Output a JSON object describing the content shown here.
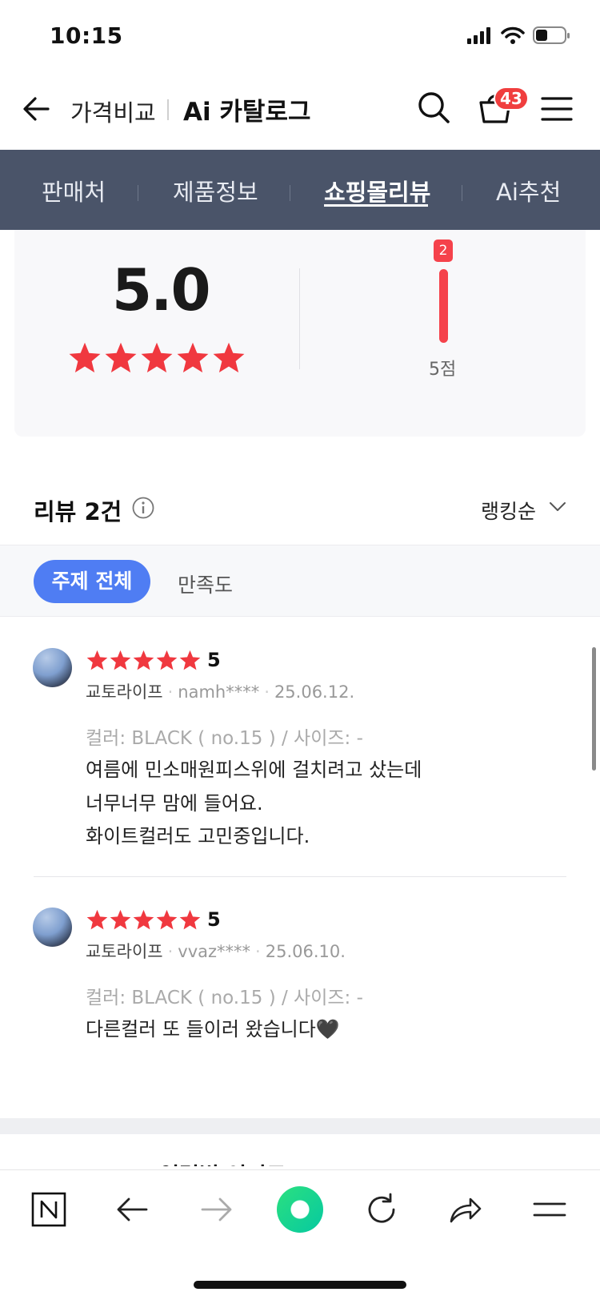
{
  "status_bar": {
    "time": "10:15"
  },
  "header": {
    "title_primary": "가격비교",
    "title_secondary": "Ai 카탈로그",
    "cart_badge": "43"
  },
  "tabs": [
    {
      "label": "판매처",
      "active": false
    },
    {
      "label": "제품정보",
      "active": false
    },
    {
      "label": "쇼핑몰리뷰",
      "active": true
    },
    {
      "label": "Ai추천",
      "active": false
    }
  ],
  "rating_summary": {
    "score": "5.0",
    "stars": 5,
    "distribution": [
      {
        "label": "5점",
        "count": "2"
      }
    ]
  },
  "reviews_header": {
    "title": "리뷰 2건",
    "sort_label": "랭킹순"
  },
  "filters": {
    "active": "주제 전체",
    "other": "만족도"
  },
  "reviews": [
    {
      "score": "5",
      "shop": "교토라이프",
      "user": "namh****",
      "date": "25.06.12.",
      "option": "컬러: BLACK ( no.15 ) / 사이즈: -",
      "lines": [
        "여름에 민소매원피스위에 걸치려고 샀는데",
        "너무너무 맘에 들어요.",
        "화이트컬러도 고민중입니다."
      ]
    },
    {
      "score": "5",
      "shop": "교토라이프",
      "user": "vvaz****",
      "date": "25.06.10.",
      "option": "컬러: BLACK ( no.15 ) / 사이즈: -",
      "lines": [
        "다른컬러 또 들이러 왔습니다🖤"
      ]
    }
  ],
  "next_section": {
    "title": "Dahaburk 연령별 인기도"
  },
  "colors": {
    "tab_bg": "#4a5469",
    "accent_red": "#f5424b",
    "chip_blue": "#4f7df3",
    "star_red": "#f0383f"
  }
}
